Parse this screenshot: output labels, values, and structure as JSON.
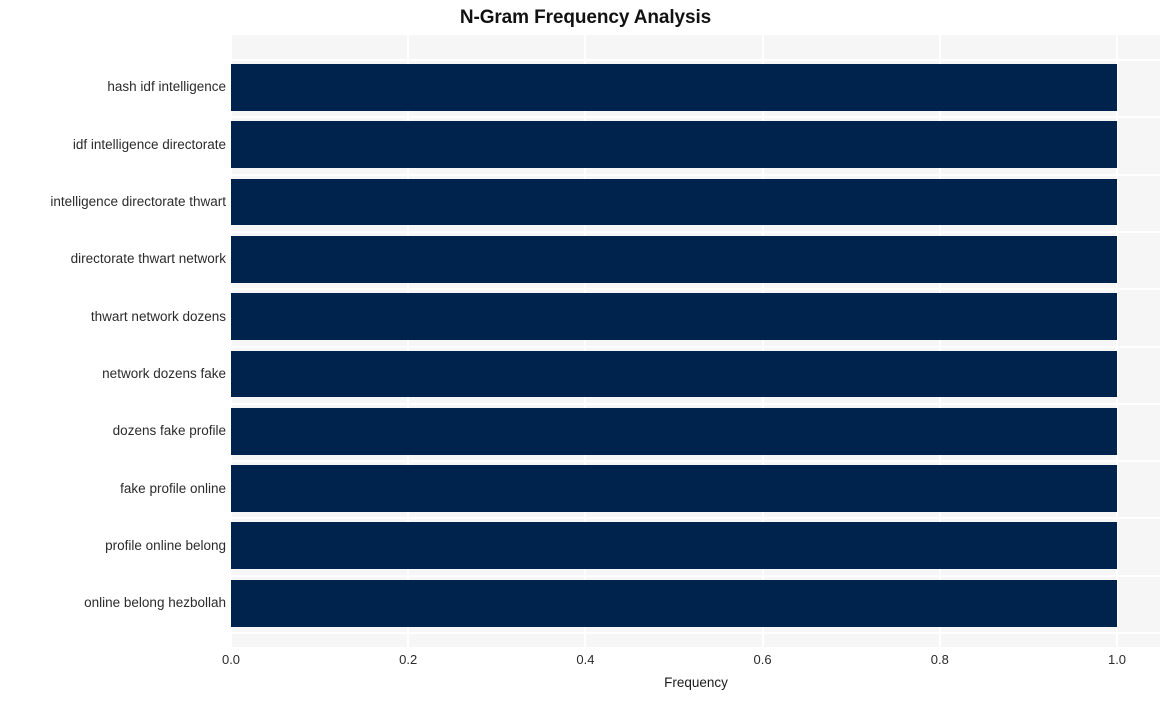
{
  "chart_data": {
    "type": "bar",
    "orientation": "horizontal",
    "title": "N-Gram Frequency Analysis",
    "xlabel": "Frequency",
    "ylabel": "",
    "categories": [
      "hash idf intelligence",
      "idf intelligence directorate",
      "intelligence directorate thwart",
      "directorate thwart network",
      "thwart network dozens",
      "network dozens fake",
      "dozens fake profile",
      "fake profile online",
      "profile online belong",
      "online belong hezbollah"
    ],
    "values": [
      1.0,
      1.0,
      1.0,
      1.0,
      1.0,
      1.0,
      1.0,
      1.0,
      1.0,
      1.0
    ],
    "xlim": [
      0.0,
      1.0
    ],
    "xticks": [
      "0.0",
      "0.2",
      "0.4",
      "0.6",
      "0.8",
      "1.0"
    ],
    "xtick_values": [
      0.0,
      0.2,
      0.4,
      0.6,
      0.8,
      1.0
    ],
    "grid": true,
    "legend": null,
    "bar_color": "#00234d",
    "plot_background": "#f6f6f7",
    "grid_color": "#ffffff",
    "figure_background": "#ffffff"
  }
}
